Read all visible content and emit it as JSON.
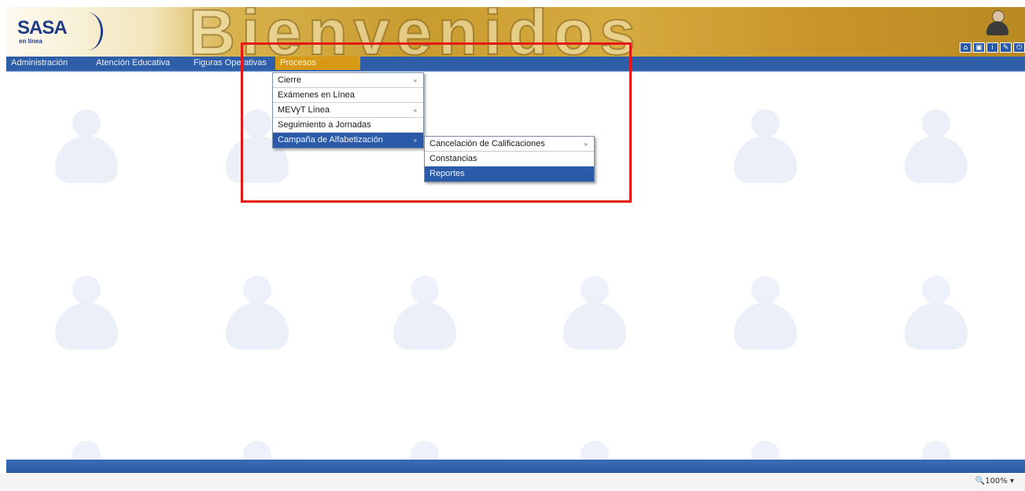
{
  "header": {
    "logo_text": "SASA",
    "logo_subtext": "en línea",
    "welcome_text": "Bienvenidos",
    "toolbar_icons": [
      "home-icon",
      "window-icon",
      "info-icon",
      "edit-icon",
      "exit-icon"
    ],
    "toolbar_glyphs": [
      "⌂",
      "▣",
      "i",
      "✎",
      "⏻"
    ]
  },
  "menubar": {
    "items": [
      {
        "label": "Administración"
      },
      {
        "label": "Atención Educativa"
      },
      {
        "label": "Figuras Operativas"
      },
      {
        "label": "Procesos"
      }
    ]
  },
  "dropdown_procesos": {
    "items": [
      {
        "label": "Cierre",
        "arrow": "»"
      },
      {
        "label": "Exámenes en Línea",
        "arrow": ""
      },
      {
        "label": "MEVyT Línea",
        "arrow": "»"
      },
      {
        "label": "Seguimiento a Jornadas",
        "arrow": ""
      },
      {
        "label": "Campaña de Alfabetización",
        "arrow": "»"
      }
    ]
  },
  "dropdown_campana": {
    "items": [
      {
        "label": "Cancelación de Calificaciones",
        "arrow": "»"
      },
      {
        "label": "Constancias",
        "arrow": ""
      },
      {
        "label": "Reportes",
        "arrow": ""
      }
    ]
  },
  "statusbar": {
    "zoom": "🔍100%  ▾"
  },
  "colors": {
    "menubar": "#2e5ea7",
    "active_menu": "#d89a16",
    "highlight": "#2a5aa8",
    "red_box": "#e41616"
  }
}
